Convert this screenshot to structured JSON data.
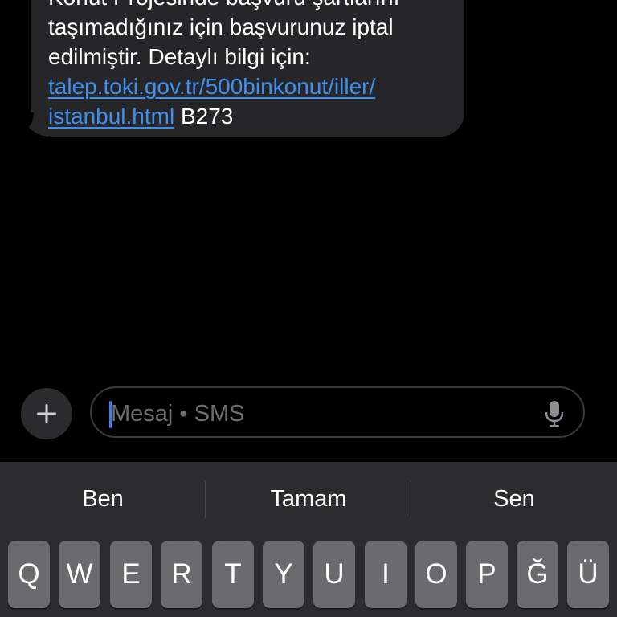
{
  "message": {
    "lines": [
      "Konut Projesinde başvuru şartlarını",
      "taşımadığınız için başvurunuz iptal",
      "edilmiştir. Detaylı bilgi için:"
    ],
    "link_line1": "talep.toki.gov.tr/500binkonut/iller/",
    "link_line2": "istanbul.html",
    "suffix": " B273"
  },
  "compose": {
    "plus_icon": "plus-icon",
    "placeholder": "Mesaj • SMS",
    "mic_icon": "microphone-icon"
  },
  "keyboard": {
    "suggestions": [
      "Ben",
      "Tamam",
      "Sen"
    ],
    "row1": [
      "Q",
      "W",
      "E",
      "R",
      "T",
      "Y",
      "U",
      "I",
      "O",
      "P",
      "Ğ",
      "Ü"
    ]
  },
  "colors": {
    "background": "#000000",
    "bubble": "#262628",
    "link": "#3e8ff2",
    "keyboard": "#2c2c2e",
    "key": "#6b6b6e"
  }
}
